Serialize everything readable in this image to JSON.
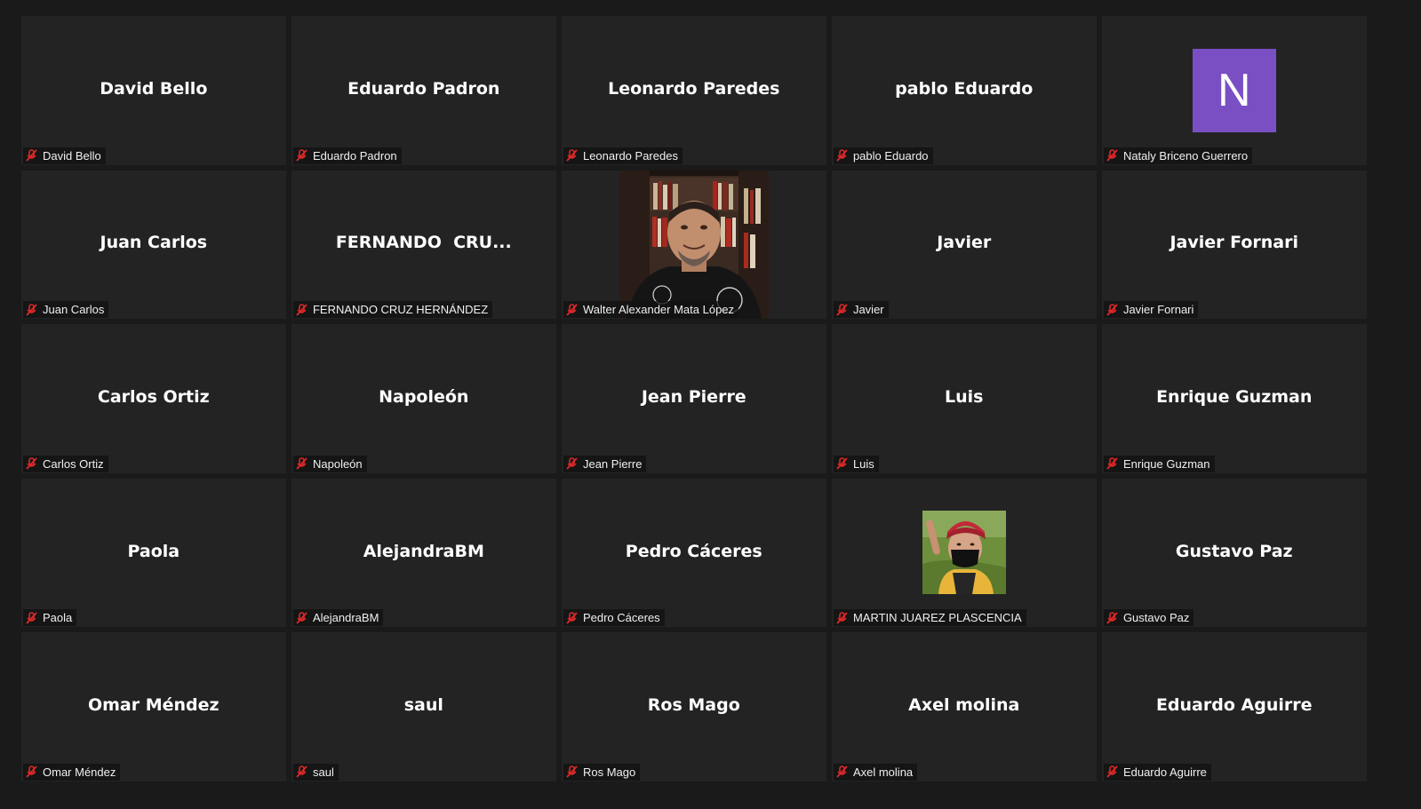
{
  "tiles": [
    {
      "display": "David Bello",
      "label": "David Bello"
    },
    {
      "display": "Eduardo Padron",
      "label": "Eduardo Padron"
    },
    {
      "display": "Leonardo Paredes",
      "label": "Leonardo Paredes"
    },
    {
      "display": "pablo Eduardo",
      "label": "pablo Eduardo"
    },
    {
      "avatar_letter": "N",
      "avatar_color": "#7b4fc4",
      "label": "Nataly Briceno Guerrero"
    },
    {
      "display": "Juan Carlos",
      "label": "Juan Carlos"
    },
    {
      "display": "FERNANDO  CRU...",
      "label": "FERNANDO CRUZ HERNÁNDEZ"
    },
    {
      "video": "webcam-photo",
      "label": "Walter Alexander Mata López"
    },
    {
      "display": "Javier",
      "label": "Javier"
    },
    {
      "display": "Javier Fornari",
      "label": "Javier Fornari"
    },
    {
      "display": "Carlos Ortiz",
      "label": "Carlos Ortiz"
    },
    {
      "display": "Napoleón",
      "label": "Napoleón"
    },
    {
      "display": "Jean Pierre",
      "label": "Jean Pierre"
    },
    {
      "display": "Luis",
      "label": "Luis"
    },
    {
      "display": "Enrique Guzman",
      "label": "Enrique Guzman"
    },
    {
      "display": "Paola",
      "label": "Paola"
    },
    {
      "display": "AlejandraBM",
      "label": "AlejandraBM"
    },
    {
      "display": "Pedro Cáceres",
      "label": "Pedro Cáceres"
    },
    {
      "profile_photo": "profile-photo",
      "label": "MARTIN JUAREZ PLASCENCIA"
    },
    {
      "display": "Gustavo Paz",
      "label": "Gustavo Paz"
    },
    {
      "display": "Omar Méndez",
      "label": "Omar Méndez"
    },
    {
      "display": "saul",
      "label": "saul"
    },
    {
      "display": "Ros Mago",
      "label": "Ros Mago"
    },
    {
      "display": "Axel molina",
      "label": "Axel molina"
    },
    {
      "display": "Eduardo Aguirre",
      "label": "Eduardo Aguirre"
    }
  ],
  "icons": {
    "muted": "muted-microphone-icon"
  },
  "colors": {
    "background": "#1a1a1a",
    "tile": "#232323",
    "mute_red": "#e02828",
    "avatar": "#7b4fc4"
  }
}
